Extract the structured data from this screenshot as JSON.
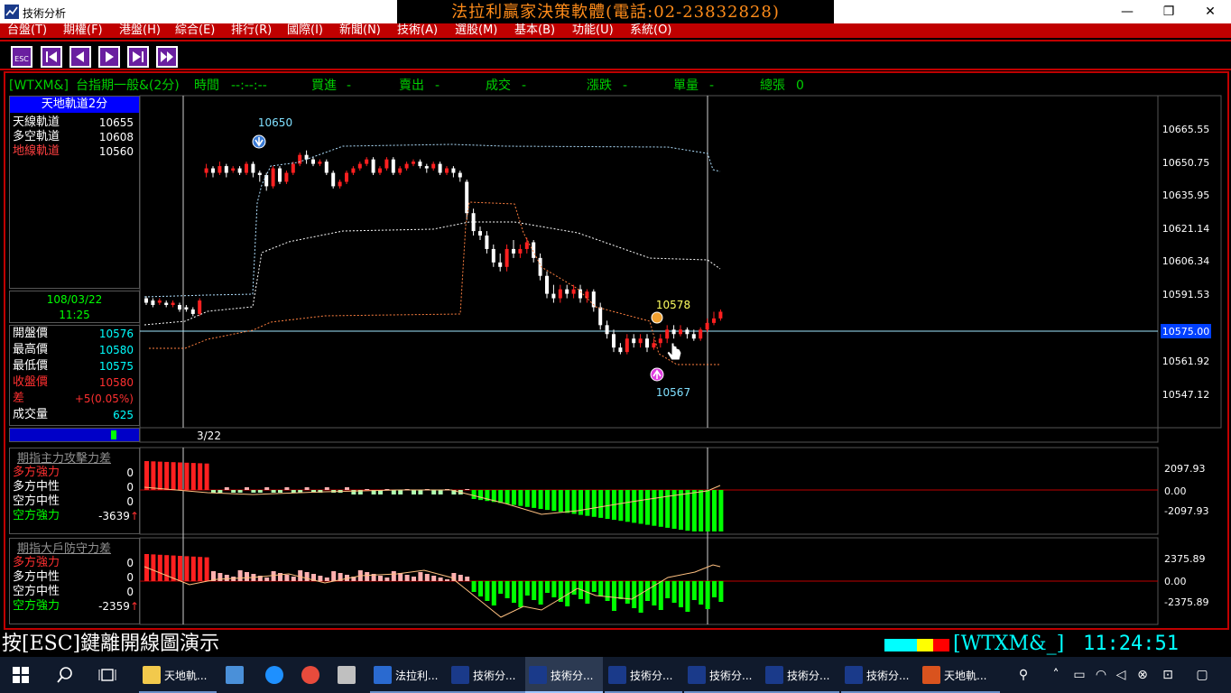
{
  "window": {
    "title": "技術分析",
    "banner": "法拉利贏家決策軟體(電話:02-23832828)"
  },
  "menu": [
    "台盤(T)",
    "期權(F)",
    "港盤(H)",
    "綜合(E)",
    "排行(R)",
    "國際(I)",
    "新聞(N)",
    "技術(A)",
    "選股(M)",
    "基本(B)",
    "功能(U)",
    "系統(O)"
  ],
  "toolbar": {
    "esc_label": "ESC",
    "buttons": [
      "esc-button",
      "first-button",
      "prev-button",
      "next-button",
      "last-button",
      "fast-forward-button"
    ]
  },
  "info": {
    "symbol": "[WTXM&]",
    "name": "台指期一般&(2分)",
    "time_label": "時間",
    "time_value": "--:--:--",
    "bid_label": "買進",
    "bid_value": "-",
    "ask_label": "賣出",
    "ask_value": "-",
    "deal_label": "成交",
    "deal_value": "-",
    "change_label": "漲跌",
    "change_value": "-",
    "vol_label": "單量",
    "vol_value": "-",
    "total_label": "總張",
    "total_value": "0"
  },
  "indicator": {
    "title": "天地軌道2分",
    "rows": [
      {
        "label": "天線軌道",
        "value": "10655",
        "color": "#ffffff"
      },
      {
        "label": "多空軌道",
        "value": "10608",
        "color": "#ffffff"
      },
      {
        "label": "地線軌道",
        "value": "10560",
        "color": "#ff4040"
      }
    ]
  },
  "quote": {
    "date": "108/03/22",
    "time": "11:25",
    "rows": [
      {
        "label": "開盤價",
        "value": "10576",
        "label_color": "#ffffff",
        "value_color": "#00ffff"
      },
      {
        "label": "最高價",
        "value": "10580",
        "label_color": "#ffffff",
        "value_color": "#00ffff"
      },
      {
        "label": "最低價",
        "value": "10575",
        "label_color": "#ffffff",
        "value_color": "#00ffff"
      },
      {
        "label": "收盤價",
        "value": "10580",
        "label_color": "#ff3030",
        "value_color": "#ff3030"
      },
      {
        "label": "差",
        "value": "+5(0.05%)",
        "label_color": "#ff3030",
        "value_color": "#ff3030"
      },
      {
        "label": "成交量",
        "value": "625",
        "label_color": "#ffffff",
        "value_color": "#00ffff"
      }
    ]
  },
  "panel2": {
    "title": "期指主力攻擊力差",
    "rows": [
      {
        "label": "多方強力",
        "value": "0",
        "color": "#ff3030"
      },
      {
        "label": "多方中性",
        "value": "0",
        "color": "#ffffff"
      },
      {
        "label": "空方中性",
        "value": "0",
        "color": "#ffffff"
      },
      {
        "label": "空方強力",
        "value": "-3639",
        "color": "#00ff00",
        "arrow": "↑"
      }
    ],
    "ticks": [
      "2097.93",
      "0.00",
      "-2097.93"
    ]
  },
  "panel3": {
    "title": "期指大戶防守力差",
    "rows": [
      {
        "label": "多方強力",
        "value": "0",
        "color": "#ff3030"
      },
      {
        "label": "多方中性",
        "value": "0",
        "color": "#ffffff"
      },
      {
        "label": "空方中性",
        "value": "0",
        "color": "#ffffff"
      },
      {
        "label": "空方強力",
        "value": "-2359",
        "color": "#00ff00",
        "arrow": "↑"
      }
    ],
    "ticks": [
      "2375.89",
      "0.00",
      "-2375.89"
    ]
  },
  "chart_data": {
    "type": "candlestick",
    "x_label_date": "3/22",
    "y_ticks": [
      "10665.55",
      "10650.75",
      "10635.95",
      "10621.14",
      "10606.34",
      "10591.53",
      "10575.00",
      "10561.92",
      "10547.12"
    ],
    "current_price": "10575.00",
    "annotations": [
      {
        "label": "10650",
        "kind": "high-marker"
      },
      {
        "label": "10578",
        "kind": "mid-marker"
      },
      {
        "label": "10567",
        "kind": "low-marker"
      }
    ],
    "bands": {
      "upper": "#b0e0ff",
      "middle": "#ffffff",
      "lower": "#ff8040"
    }
  },
  "status": {
    "message": "按[ESC]鍵離開線圖演示",
    "symbol": "[WTXM&_]",
    "time": "11:24:51",
    "colors": [
      "#00ffff",
      "#00ffff",
      "#ffff00",
      "#ff0000"
    ]
  },
  "taskbar": {
    "items": [
      {
        "label": "天地軌...",
        "icon": "folder-icon",
        "active": false
      },
      {
        "label": "",
        "icon": "desktop-icon",
        "active": false
      },
      {
        "label": "",
        "icon": "ie-icon",
        "active": false
      },
      {
        "label": "",
        "icon": "chrome-icon",
        "active": false
      },
      {
        "label": "",
        "icon": "paint-icon",
        "active": false
      },
      {
        "label": "法拉利...",
        "icon": "app-icon",
        "active": false
      },
      {
        "label": "技術分...",
        "icon": "chart-icon",
        "active": false
      },
      {
        "label": "技術分...",
        "icon": "chart-icon",
        "active": true
      },
      {
        "label": "技術分...",
        "icon": "chart-icon",
        "active": false
      },
      {
        "label": "技術分...",
        "icon": "chart-icon",
        "active": false
      },
      {
        "label": "技術分...",
        "icon": "chart-icon",
        "active": false
      },
      {
        "label": "技術分...",
        "icon": "chart-icon",
        "active": false
      },
      {
        "label": "天地軌...",
        "icon": "powerpoint-icon",
        "active": false
      }
    ]
  }
}
